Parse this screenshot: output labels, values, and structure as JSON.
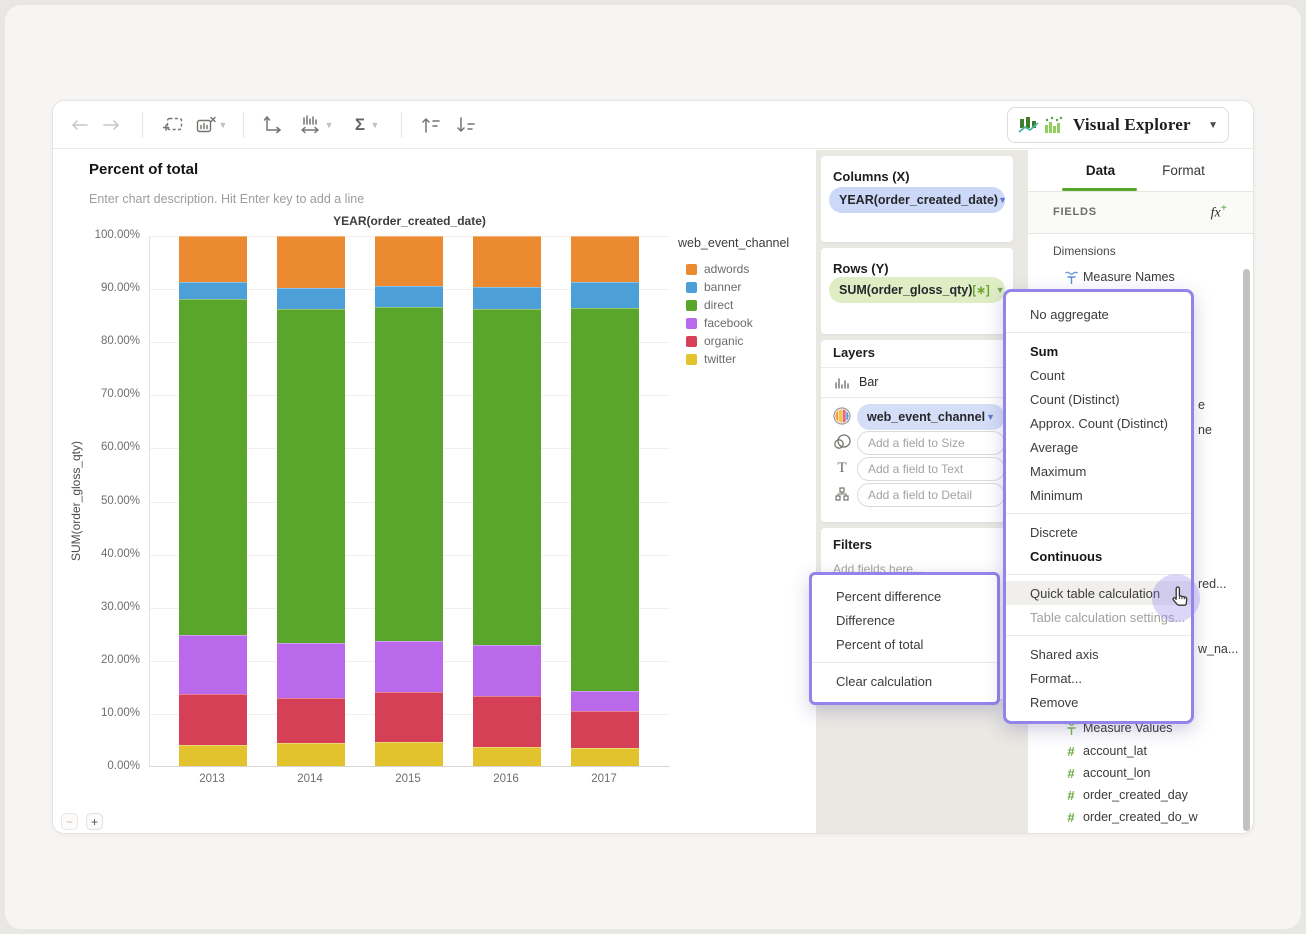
{
  "explorer": {
    "label": "Visual Explorer"
  },
  "toolbar": {
    "icons": [
      "back",
      "forward",
      "duplicate-chart",
      "delete-chart",
      "swap-axes",
      "bin-settings",
      "aggregate-sigma",
      "sort-ascending",
      "sort-descending"
    ]
  },
  "chart": {
    "title": "Percent of total",
    "description_placeholder": "Enter chart description. Hit Enter key to add a line",
    "zoom_out": "−",
    "zoom_in": "+"
  },
  "chart_data": {
    "type": "bar",
    "subtype": "stacked-percent",
    "title": "YEAR(order_created_date)",
    "ylabel": "SUM(order_gloss_qty)",
    "xlabel": "",
    "ylim": [
      0,
      100
    ],
    "grid": true,
    "y_ticks": [
      "100.00%",
      "90.00%",
      "80.00%",
      "70.00%",
      "60.00%",
      "50.00%",
      "40.00%",
      "30.00%",
      "20.00%",
      "10.00%",
      "0.00%"
    ],
    "x_categories": [
      "2013",
      "2014",
      "2015",
      "2016",
      "2017"
    ],
    "legend_title": "web_event_channel",
    "legend_position": "right",
    "series": [
      {
        "name": "adwords",
        "color": "#EB8A31",
        "values": [
          8.6,
          9.8,
          9.4,
          9.6,
          8.6
        ]
      },
      {
        "name": "banner",
        "color": "#4D9FD8",
        "values": [
          3.3,
          4.0,
          4.0,
          4.2,
          5.0
        ]
      },
      {
        "name": "direct",
        "color": "#5AA62C",
        "values": [
          63.3,
          63.0,
          63.0,
          63.3,
          72.2
        ]
      },
      {
        "name": "facebook",
        "color": "#B969E9",
        "values": [
          11.3,
          10.3,
          9.7,
          9.6,
          3.8
        ]
      },
      {
        "name": "organic",
        "color": "#D54056",
        "values": [
          9.6,
          8.6,
          9.4,
          9.7,
          7.0
        ]
      },
      {
        "name": "twitter",
        "color": "#E2C32D",
        "values": [
          3.9,
          4.3,
          4.5,
          3.6,
          3.4
        ]
      }
    ],
    "stack_order_bottom_to_top": [
      "twitter",
      "organic",
      "facebook",
      "direct",
      "banner",
      "adwords"
    ]
  },
  "panels": {
    "columns": {
      "header": "Columns (X)",
      "pill": "YEAR(order_created_date)"
    },
    "rows": {
      "header": "Rows (Y)",
      "pill": "SUM(order_gloss_qty)",
      "badge": "[∗]"
    },
    "layers": {
      "header": "Layers",
      "mark_type": "Bar",
      "color_pill": "web_event_channel",
      "size_placeholder": "Add a field to Size",
      "text_placeholder": "Add a field to Text",
      "detail_placeholder": "Add a field to Detail"
    },
    "filters": {
      "header": "Filters",
      "placeholder": "Add fields here..."
    }
  },
  "menus": {
    "calculation_menu": {
      "items": [
        {
          "label": "Percent difference"
        },
        {
          "label": "Difference"
        },
        {
          "label": "Percent of total"
        },
        {
          "label": "Clear calculation",
          "divider_before": true
        }
      ]
    },
    "field_menu": {
      "items": [
        {
          "label": "No aggregate"
        },
        {
          "label": "Sum",
          "bold": true,
          "divider_before": true
        },
        {
          "label": "Count"
        },
        {
          "label": "Count (Distinct)"
        },
        {
          "label": "Approx. Count (Distinct)"
        },
        {
          "label": "Average"
        },
        {
          "label": "Maximum"
        },
        {
          "label": "Minimum"
        },
        {
          "label": "Discrete",
          "divider_before": true
        },
        {
          "label": "Continuous",
          "bold": true
        },
        {
          "label": "Quick table calculation",
          "divider_before": true,
          "hover": true
        },
        {
          "label": "Table calculation settings...",
          "disabled": true
        },
        {
          "label": "Shared axis",
          "divider_before": true
        },
        {
          "label": "Format..."
        },
        {
          "label": "Remove"
        }
      ]
    }
  },
  "fields_panel": {
    "tabs": [
      {
        "label": "Data",
        "active": true
      },
      {
        "label": "Format",
        "active": false
      }
    ],
    "section_header": "FIELDS",
    "fx_label": "fx",
    "fx_plus": "+",
    "dimensions_label": "Dimensions",
    "visible_fields_top": [
      {
        "label": "Measure Names",
        "icon": "measure-names"
      }
    ],
    "hidden_fragments": [
      "e",
      "ne",
      "red...",
      "w_na..."
    ],
    "visible_fields_bottom": [
      {
        "label": "Measure Values",
        "icon": "measure-values"
      },
      {
        "label": "account_lat",
        "icon": "number"
      },
      {
        "label": "account_lon",
        "icon": "number"
      },
      {
        "label": "order_created_day",
        "icon": "number"
      },
      {
        "label": "order_created_do_w",
        "icon": "number"
      }
    ]
  },
  "colors": {
    "accent_green": "#56a52c",
    "menu_border": "#9184ea",
    "columns_pill_bg": "#cbd8f7",
    "rows_pill_bg": "#dfedc5",
    "color_pill_bg": "#d4def6",
    "badge_green": "#6ba32f",
    "mid_column_bg": "#e9e8e2"
  }
}
